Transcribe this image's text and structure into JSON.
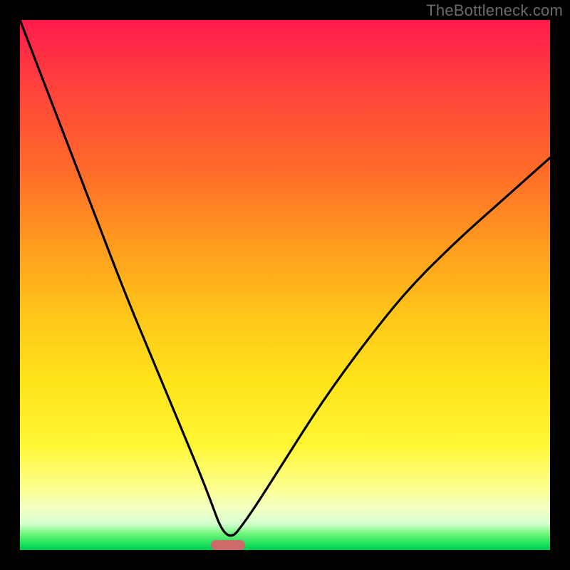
{
  "watermark": "TheBottleneck.com",
  "colors": {
    "frame": "#000000",
    "gradient_stops": [
      "#ff1a4d",
      "#ff6a2a",
      "#ffc41a",
      "#fff633",
      "#f4ffc2",
      "#18e05a",
      "#00c853"
    ],
    "curve": "#000000",
    "marker": "#cc6b6a"
  },
  "chart_data": {
    "type": "line",
    "title": "",
    "xlabel": "",
    "ylabel": "",
    "xlim": [
      0,
      1
    ],
    "ylim": [
      0,
      1
    ],
    "annotations": [
      "TheBottleneck.com"
    ],
    "notes": "Bottleneck curve. Single V-shaped curve with minimum near x≈0.39. Background heat gradient: red (high/bad) at top to green (low/good) at bottom. Small rounded marker at the curve minimum.",
    "series": [
      {
        "name": "bottleneck-curve",
        "x": [
          0.0,
          0.05,
          0.1,
          0.15,
          0.2,
          0.25,
          0.3,
          0.35,
          0.39,
          0.43,
          0.5,
          0.57,
          0.65,
          0.73,
          0.82,
          0.91,
          1.0
        ],
        "y": [
          1.0,
          0.87,
          0.74,
          0.61,
          0.48,
          0.36,
          0.24,
          0.12,
          0.01,
          0.06,
          0.17,
          0.28,
          0.39,
          0.49,
          0.58,
          0.66,
          0.74
        ]
      }
    ],
    "marker": {
      "x": 0.392,
      "y": 0.01
    }
  }
}
